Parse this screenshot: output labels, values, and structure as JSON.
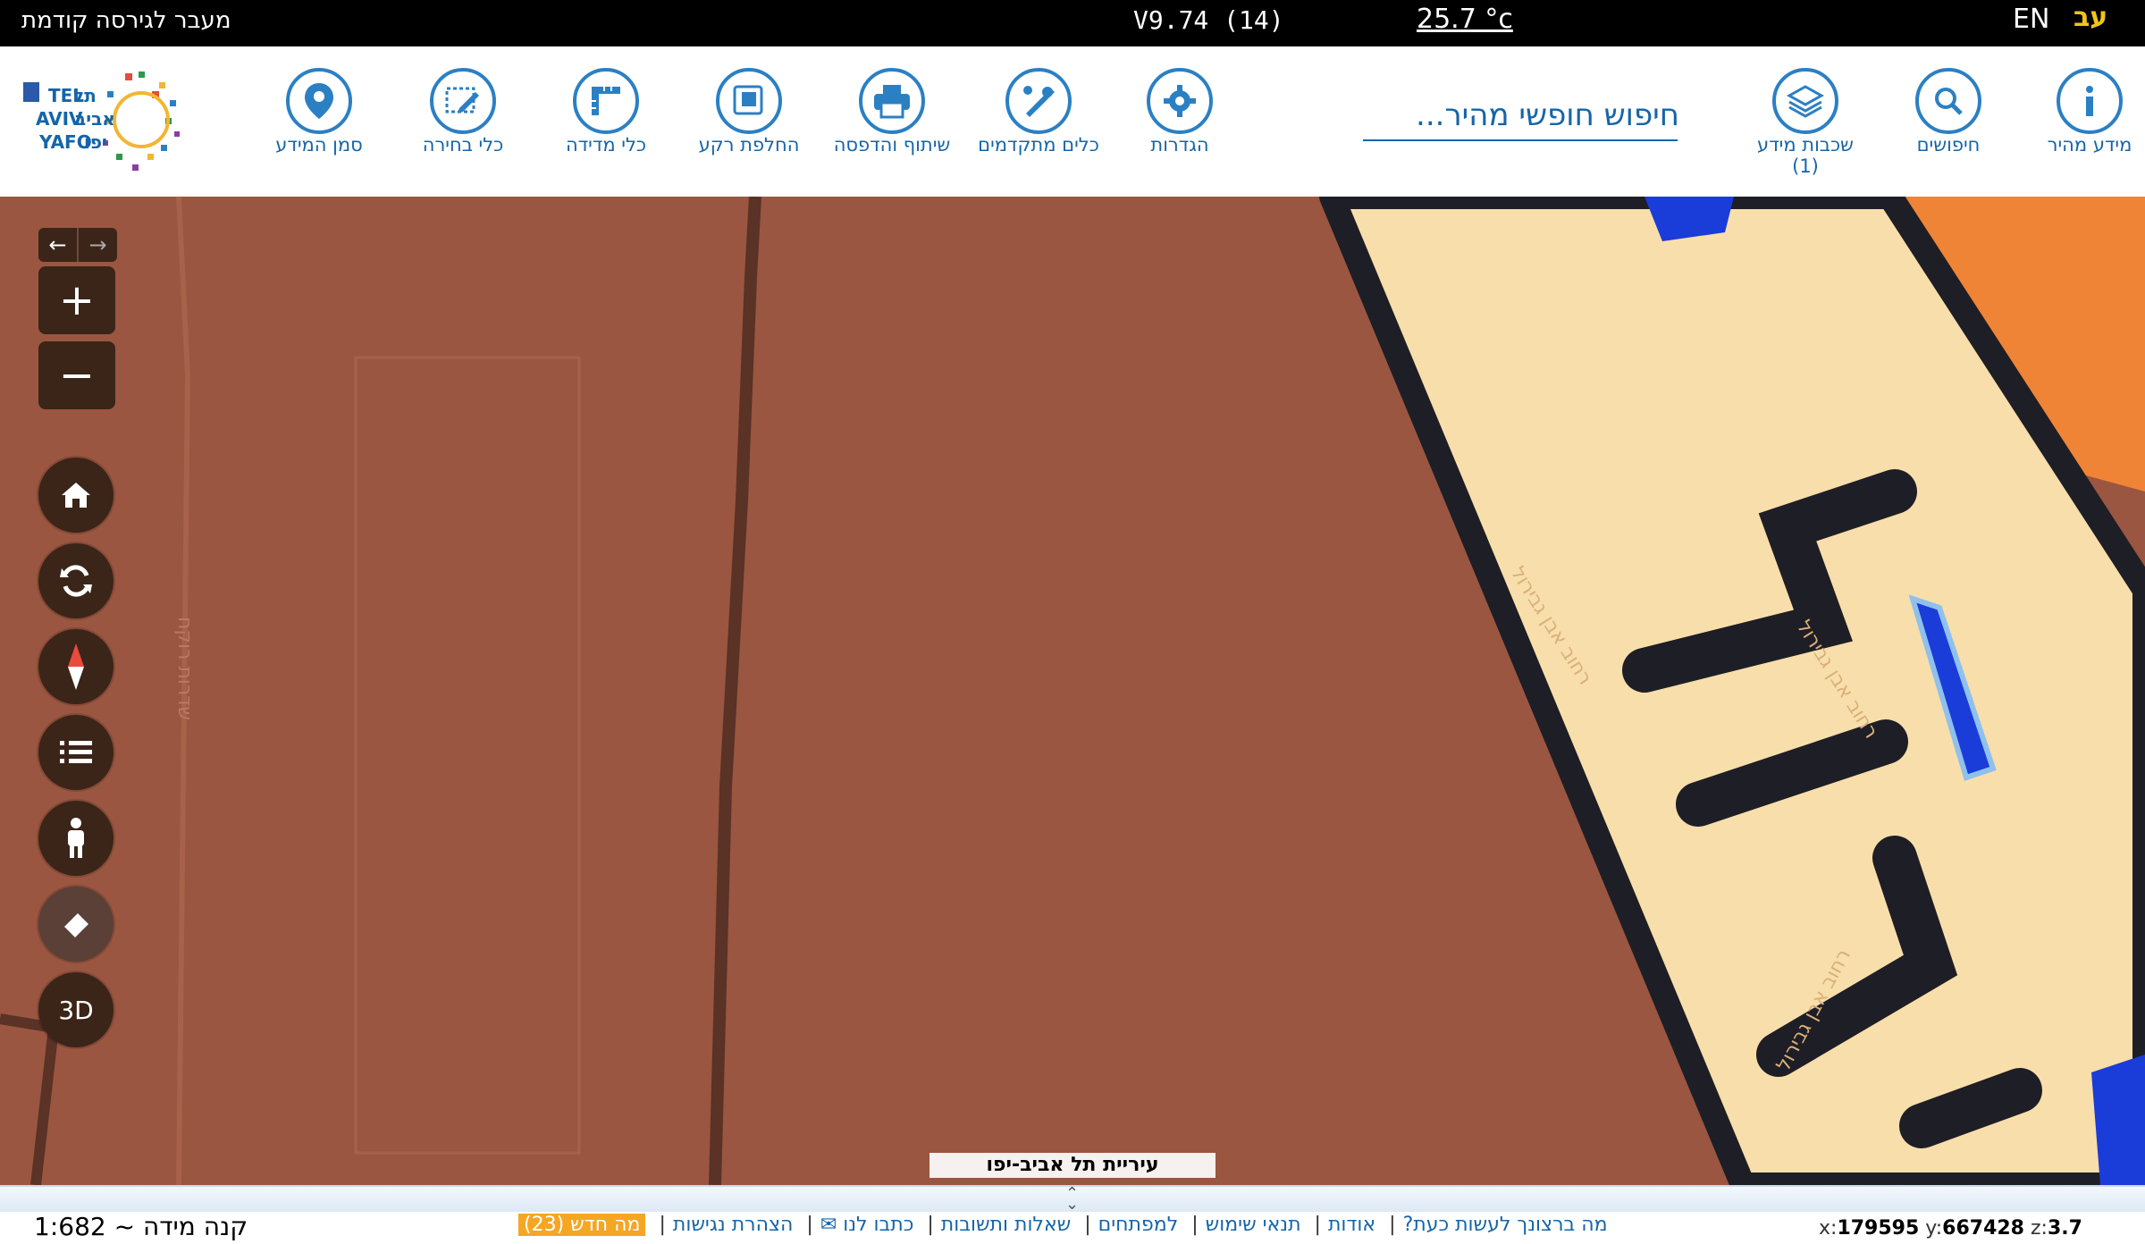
{
  "topbar": {
    "prev_version": "מעבר לגירסה קודמת",
    "version": "V9.74 (14)",
    "temperature": "25.7 °c",
    "lang_en": "EN",
    "lang_he": "עב"
  },
  "logo": {
    "text_he_1": "תל",
    "text_he_2": "אביב",
    "text_he_3": "יפו",
    "text_en_1": "TEL",
    "text_en_2": "AVIV",
    "text_en_3": "YAFO"
  },
  "toolbar": {
    "mark_info": "סמן המידע",
    "select_tools": "כלי בחירה",
    "measure_tools": "כלי מדידה",
    "switch_background": "החלפת רקע",
    "share_print": "שיתוף והדפסה",
    "advanced_tools": "כלים מתקדמים",
    "settings": "הגדרות",
    "search_placeholder": "חיפוש חופשי מהיר...",
    "info_layers": "שכבות מידע",
    "info_layers_count": "(1)",
    "searches": "חיפושים",
    "quick_info": "מידע מהיר"
  },
  "map": {
    "controls": {
      "back": "←",
      "forward": "→",
      "zoom_in": "+",
      "zoom_out": "−",
      "three_d": "3D"
    },
    "street_labels": [
      "שדרות רוקח",
      "רחוב אבן גבירול",
      "רחוב אבן גבירול",
      "רחוב אבן גבירול"
    ],
    "caption": "עיריית תל אביב-יפו"
  },
  "footer": {
    "scale_label": "קנה מידה ~ 1:682",
    "links": [
      "מה ברצונך לעשות כעת?",
      "אודות",
      "תנאי שימוש",
      "למפתחים",
      "שאלות ותשובות",
      "כתבו לנו ✉",
      "הצהרת נגישות"
    ],
    "whats_new": "מה חדש (23)",
    "coord_x_label": "x:",
    "coord_x": "179595",
    "coord_y_label": "y:",
    "coord_y": "667428",
    "coord_z_label": "z:",
    "coord_z": "3.7"
  },
  "colors": {
    "accent": "#1565a8",
    "map_parcel": "#9a5640",
    "road_fill": "#f8deaa",
    "road_edge": "#1e1e26",
    "water": "#1a3cd8",
    "orange_zone": "#ef8436"
  }
}
